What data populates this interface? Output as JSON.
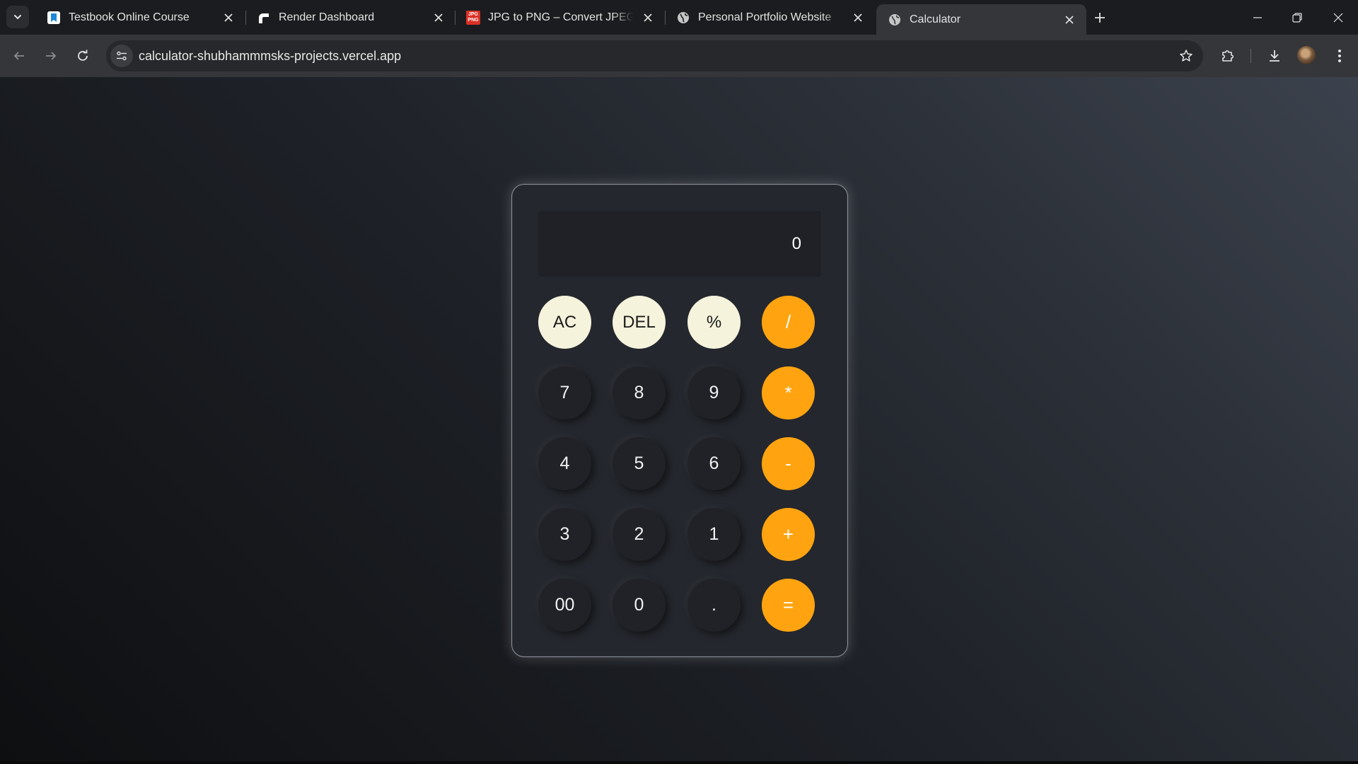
{
  "browser": {
    "tabs": [
      {
        "title": "Testbook Online Course",
        "favicon": "testbook-icon",
        "active": false
      },
      {
        "title": "Render Dashboard",
        "favicon": "render-icon",
        "active": false
      },
      {
        "title": "JPG to PNG – Convert JPEG to PNG",
        "favicon": "jpg-png-icon",
        "active": false
      },
      {
        "title": "Personal Portfolio Website",
        "favicon": "globe-icon",
        "active": false
      },
      {
        "title": "Calculator",
        "favicon": "globe-icon",
        "active": true
      }
    ],
    "url": "calculator-shubhammmsks-projects.vercel.app",
    "jpg_favicon_text_top": "JPG",
    "jpg_favicon_text_bottom": "PNG"
  },
  "calculator": {
    "display_value": "0",
    "rows": [
      [
        "AC",
        "DEL",
        "%",
        "/"
      ],
      [
        "7",
        "8",
        "9",
        "*"
      ],
      [
        "4",
        "5",
        "6",
        "-"
      ],
      [
        "3",
        "2",
        "1",
        "+"
      ],
      [
        "00",
        "0",
        ".",
        "="
      ]
    ],
    "colors": {
      "operator": "#ffa410",
      "function": "#f5f3dc",
      "number": "#202227"
    }
  }
}
